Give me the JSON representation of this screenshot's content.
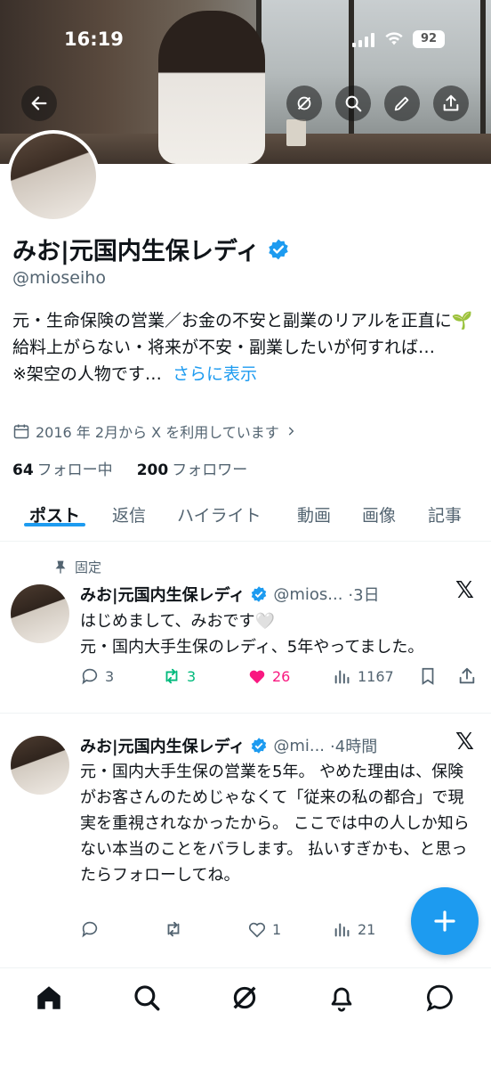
{
  "status_bar": {
    "time": "16:19",
    "battery": "92"
  },
  "profile": {
    "name": "みお|元国内生保レディ",
    "handle": "@mioseiho",
    "bio_lines": [
      "元・生命保険の営業／お金の不安と副業のリアルを正直に🌱",
      "給料上がらない・将来が不安・副業したいが何すれば…",
      "※架空の人物です…"
    ],
    "show_more": "さらに表示",
    "joined": "2016 年 2月から X を利用しています",
    "following_count": "64",
    "following_label": "フォロー中",
    "followers_count": "200",
    "followers_label": "フォロワー"
  },
  "tabs": [
    "ポスト",
    "返信",
    "ハイライト",
    "動画",
    "画像",
    "記事"
  ],
  "pinned_label": "固定",
  "posts": [
    {
      "name": "みお|元国内生保レディ",
      "handle": "@mios...",
      "time": "·3日",
      "text": "はじめまして、みおです🤍\n元・国内大手生保のレディ、5年やってました。",
      "replies": "3",
      "reposts": "3",
      "likes": "26",
      "views": "1167"
    },
    {
      "name": "みお|元国内生保レディ",
      "handle": "@mi...",
      "time": "·4時間",
      "text": "元・国内大手生保の営業を5年。 やめた理由は、保険がお客さんのためじゃなくて「従来の私の都合」で現実を重視されなかったから。 ここでは中の人しか知らない本当のことをバラします。 払いすぎかも、と思ったらフォローしてね。",
      "replies": "",
      "reposts": "",
      "likes": "1",
      "views": "21"
    }
  ],
  "colors": {
    "accent": "#1d9bf0",
    "like": "#f91880",
    "repost": "#00ba7c",
    "verified": "#1d9bf0"
  },
  "icons": [
    "back-arrow-icon",
    "grok-icon",
    "search-icon",
    "edit-icon",
    "share-icon",
    "calendar-icon",
    "pin-icon",
    "reply-icon",
    "repost-icon",
    "like-icon",
    "views-icon",
    "bookmark-icon",
    "x-logo-icon",
    "home-icon",
    "explore-icon",
    "grok-nav-icon",
    "notifications-icon",
    "messages-icon",
    "compose-icon"
  ]
}
